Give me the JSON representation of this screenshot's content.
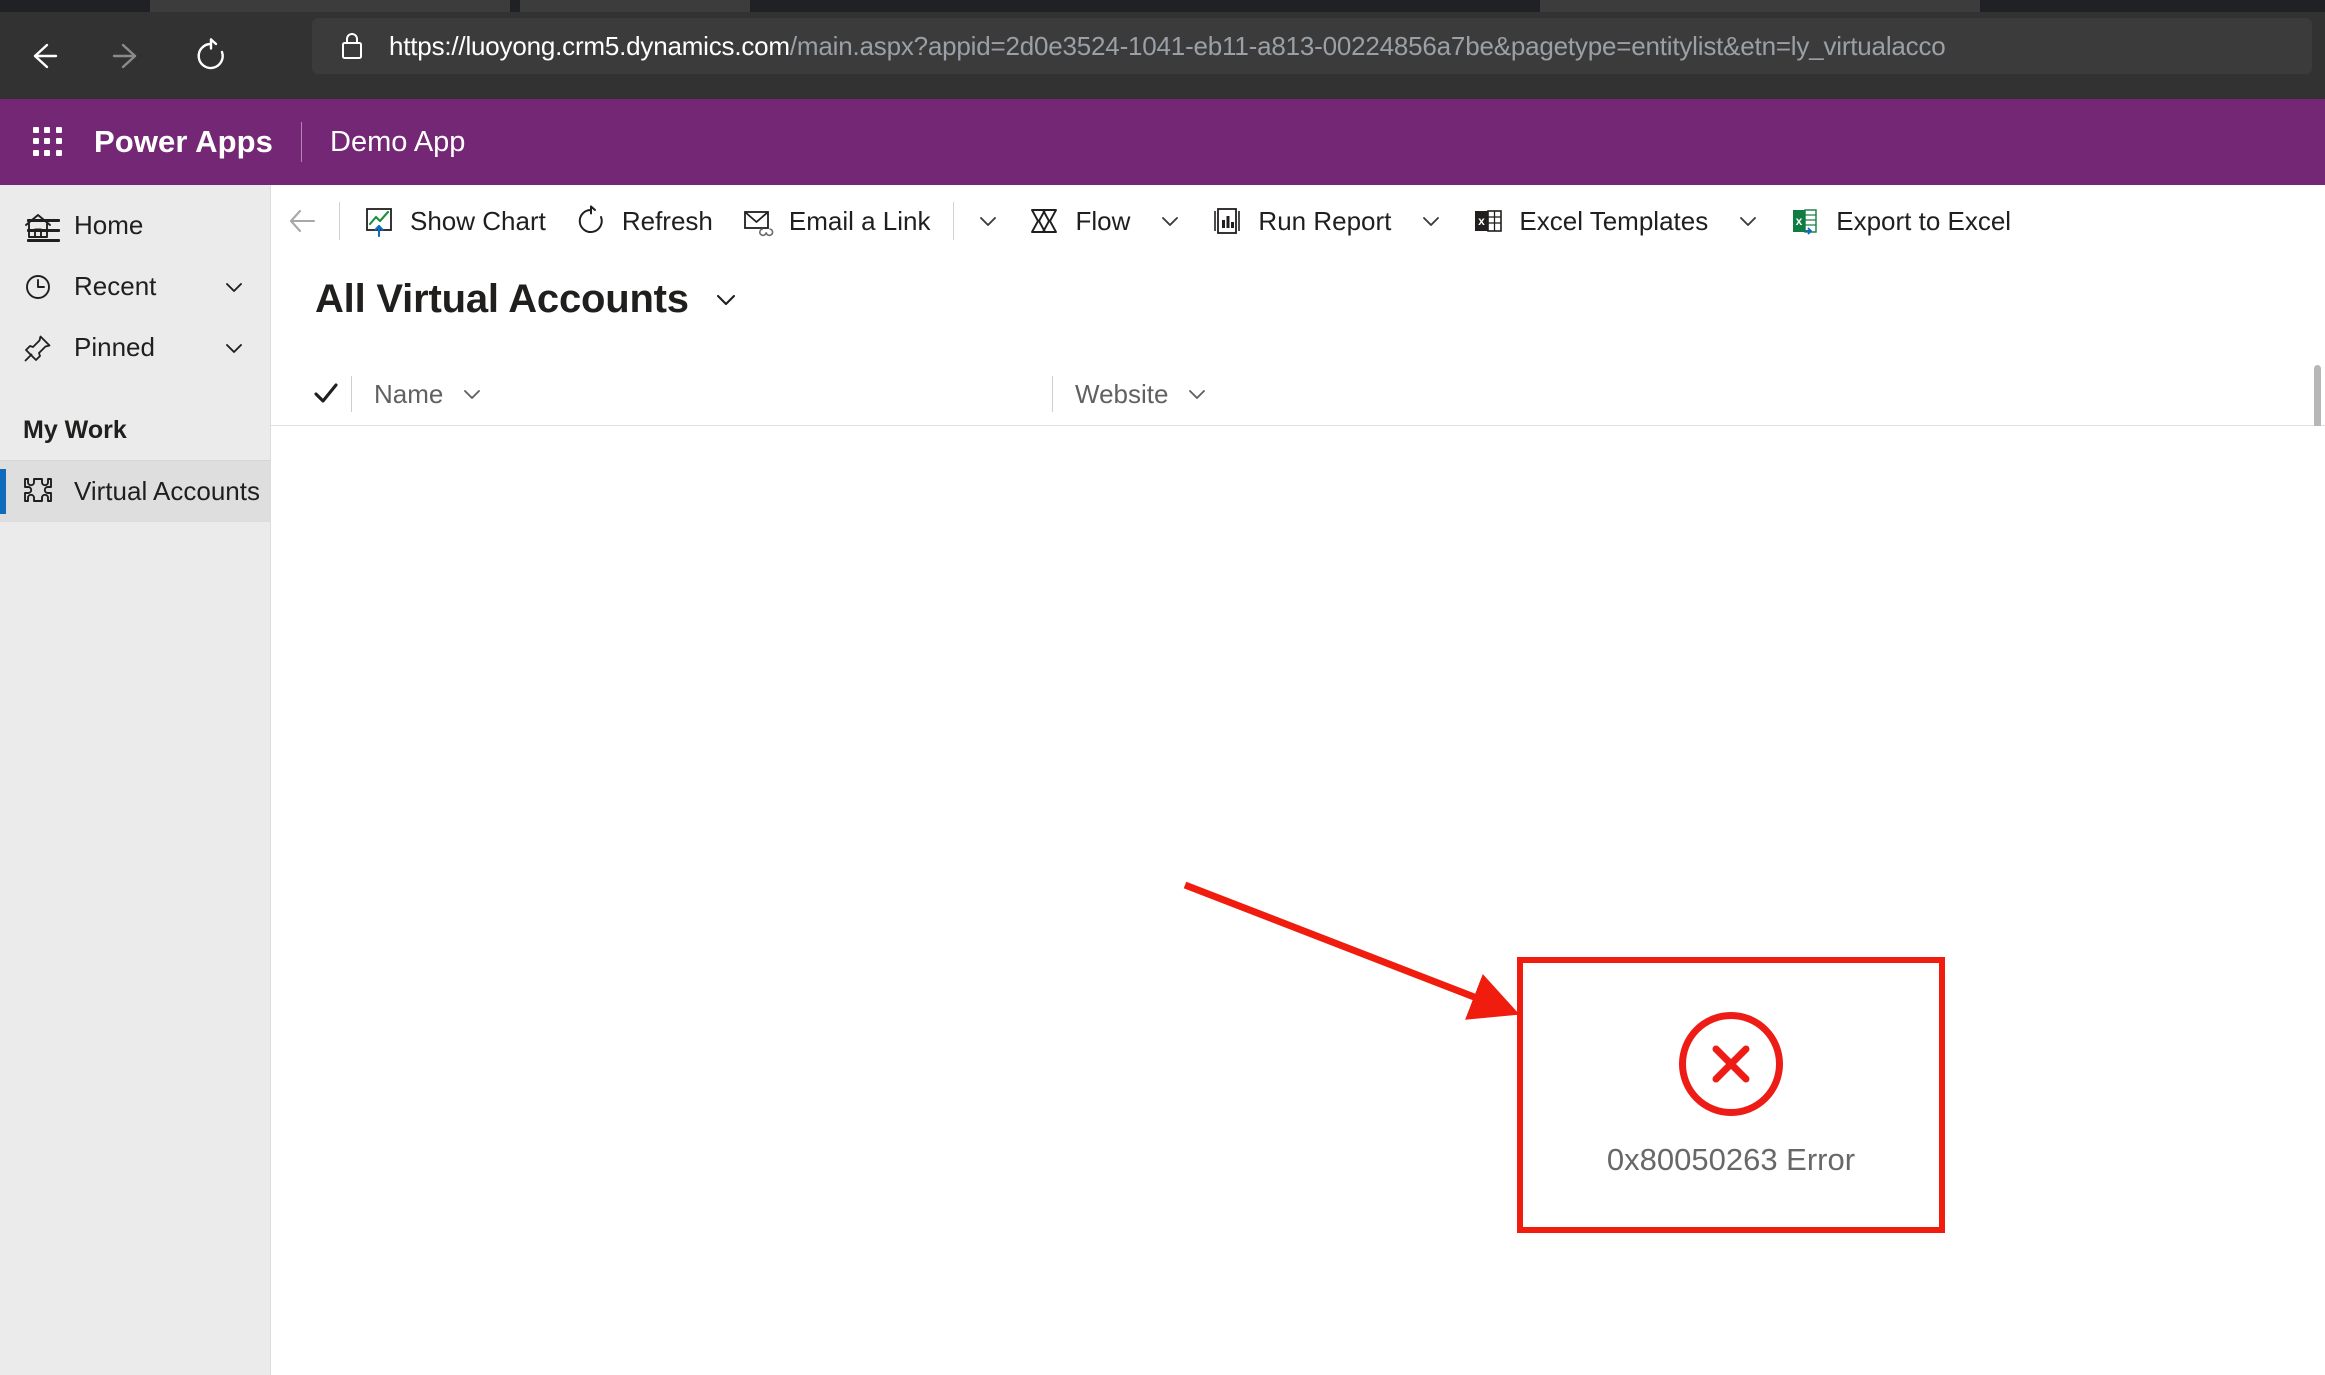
{
  "browser": {
    "back_icon": "arrow-left-icon",
    "forward_icon": "arrow-right-icon",
    "reload_icon": "reload-icon",
    "lock_icon": "lock-icon",
    "url_scheme_host": "https://luoyong.crm5.dynamics.com",
    "url_path_query": "/main.aspx?appid=2d0e3524-1041-eb11-a813-00224856a7be&pagetype=entitylist&etn=ly_virtualacco",
    "url_full": "https://luoyong.crm5.dynamics.com/main.aspx?appid=2d0e3524-1041-eb11-a813-00224856a7be&pagetype=entitylist&etn=ly_virtualacco"
  },
  "header": {
    "waffle_icon": "waffle-grid-icon",
    "brand": "Power Apps",
    "app_name": "Demo App",
    "background_color": "#742774"
  },
  "sidebar": {
    "hamburger_icon": "hamburger-icon",
    "items": [
      {
        "label": "Home",
        "icon": "home-icon",
        "chevron": false,
        "selected": false
      },
      {
        "label": "Recent",
        "icon": "clock-icon",
        "chevron": true,
        "selected": false
      },
      {
        "label": "Pinned",
        "icon": "pin-icon",
        "chevron": true,
        "selected": false
      }
    ],
    "group_title": "My Work",
    "group_items": [
      {
        "label": "Virtual Accounts",
        "icon": "puzzle-piece-icon",
        "selected": true
      }
    ],
    "selection_accent_color": "#0f6cbd",
    "background_color": "#ebebeb"
  },
  "command_bar": {
    "back_icon": "arrow-left-icon",
    "buttons": [
      {
        "label": "Show Chart",
        "icon": "show-chart-icon",
        "caret": false
      },
      {
        "label": "Refresh",
        "icon": "refresh-icon",
        "caret": false
      },
      {
        "label": "Email a Link",
        "icon": "email-link-icon",
        "caret": true
      },
      {
        "label": "Flow",
        "icon": "flow-icon",
        "caret": true
      },
      {
        "label": "Run Report",
        "icon": "run-report-icon",
        "caret": true
      },
      {
        "label": "Excel Templates",
        "icon": "excel-templates-icon",
        "caret": true
      },
      {
        "label": "Export to Excel",
        "icon": "export-excel-icon",
        "caret": false
      }
    ]
  },
  "view": {
    "title": "All Virtual Accounts",
    "caret_icon": "chevron-down-icon"
  },
  "grid": {
    "select_all_icon": "checkmark-icon",
    "columns": [
      {
        "label": "Name",
        "caret_icon": "chevron-down-icon"
      },
      {
        "label": "Website",
        "caret_icon": "chevron-down-icon"
      }
    ],
    "rows": []
  },
  "annotation": {
    "arrow_icon": "red-arrow-icon",
    "error_icon": "error-circle-x-icon",
    "error_text": "0x80050263 Error",
    "accent_color": "#ed1c16"
  }
}
